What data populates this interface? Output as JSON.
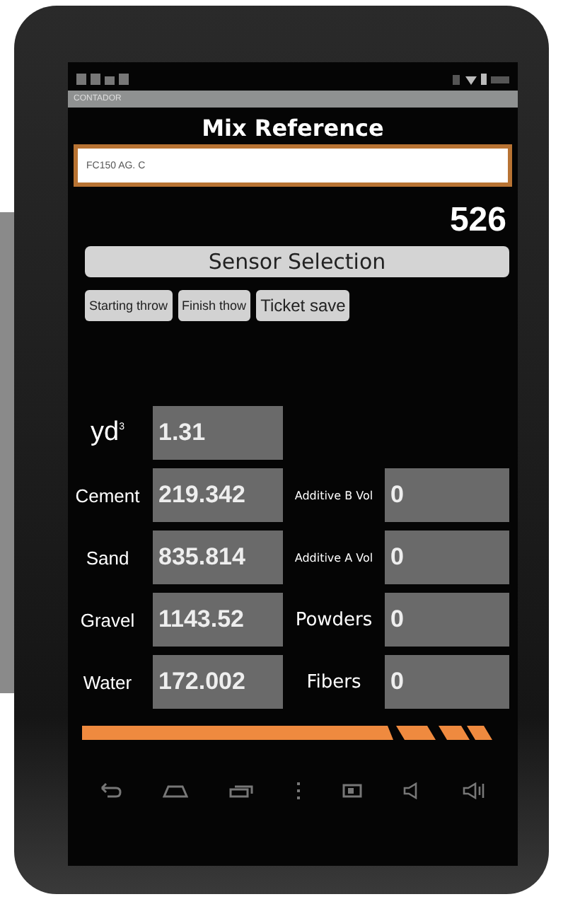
{
  "status_bar": {
    "app_title": "CONTADOR"
  },
  "mix_reference": {
    "label": "Mix Reference",
    "value": "FC150 AG. C"
  },
  "counter": "526",
  "sensor_button": "Sensor Selection",
  "actions": [
    "Starting throw",
    "Finish thow",
    "Ticket save"
  ],
  "volume": {
    "unit": "yd",
    "exponent": "3",
    "value": "1.31"
  },
  "rows": [
    {
      "label": "Cement",
      "value": "219.342",
      "label_2": "Additive B Vol",
      "value_2": "0",
      "small": true
    },
    {
      "label": "Sand",
      "value": "835.814",
      "label_2": "Additive A Vol",
      "value_2": "0",
      "small": true
    },
    {
      "label": "Gravel",
      "value": "1143.52",
      "label_2": "Powders",
      "value_2": "0",
      "small": false
    },
    {
      "label": "Water",
      "value": "172.002",
      "label_2": "Fibers",
      "value_2": "0",
      "small": false
    }
  ]
}
